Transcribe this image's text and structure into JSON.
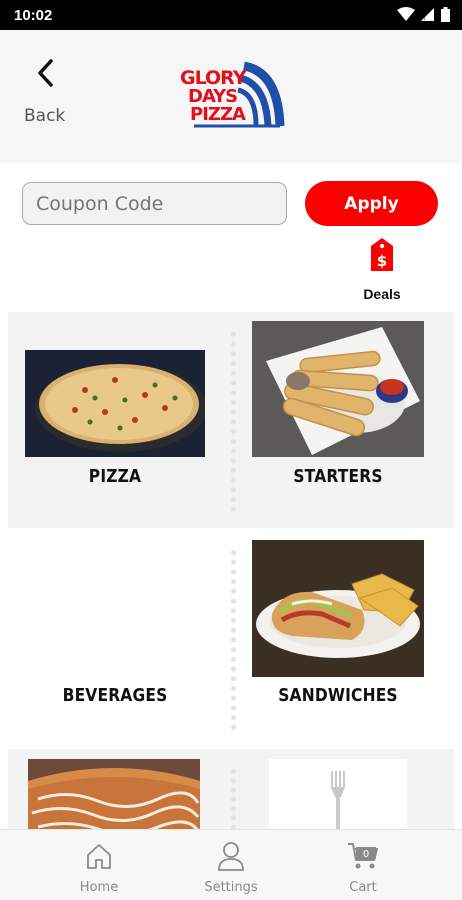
{
  "status_bar": {
    "time": "10:02"
  },
  "header": {
    "back_label": "Back",
    "logo": {
      "name": "glory-days-pizza-logo",
      "text_lines": [
        "GLORY",
        "DAYS",
        "PIZZA"
      ],
      "colors": {
        "text": "#e3101a",
        "arc": "#1f4fa8"
      }
    }
  },
  "coupon": {
    "placeholder": "Coupon Code",
    "apply_label": "Apply"
  },
  "deals": {
    "label": "Deals",
    "icon": "price-tag-icon"
  },
  "categories": [
    {
      "label": "PIZZA"
    },
    {
      "label": "STARTERS"
    },
    {
      "label": "BEVERAGES"
    },
    {
      "label": "SANDWICHES"
    }
  ],
  "nav": [
    {
      "label": "Home",
      "icon": "home-icon"
    },
    {
      "label": "Settings",
      "icon": "user-icon"
    },
    {
      "label": "Cart",
      "icon": "cart-icon",
      "badge": "0"
    }
  ],
  "colors": {
    "accent": "#fb0000",
    "nav_text": "#8a8a8a"
  }
}
